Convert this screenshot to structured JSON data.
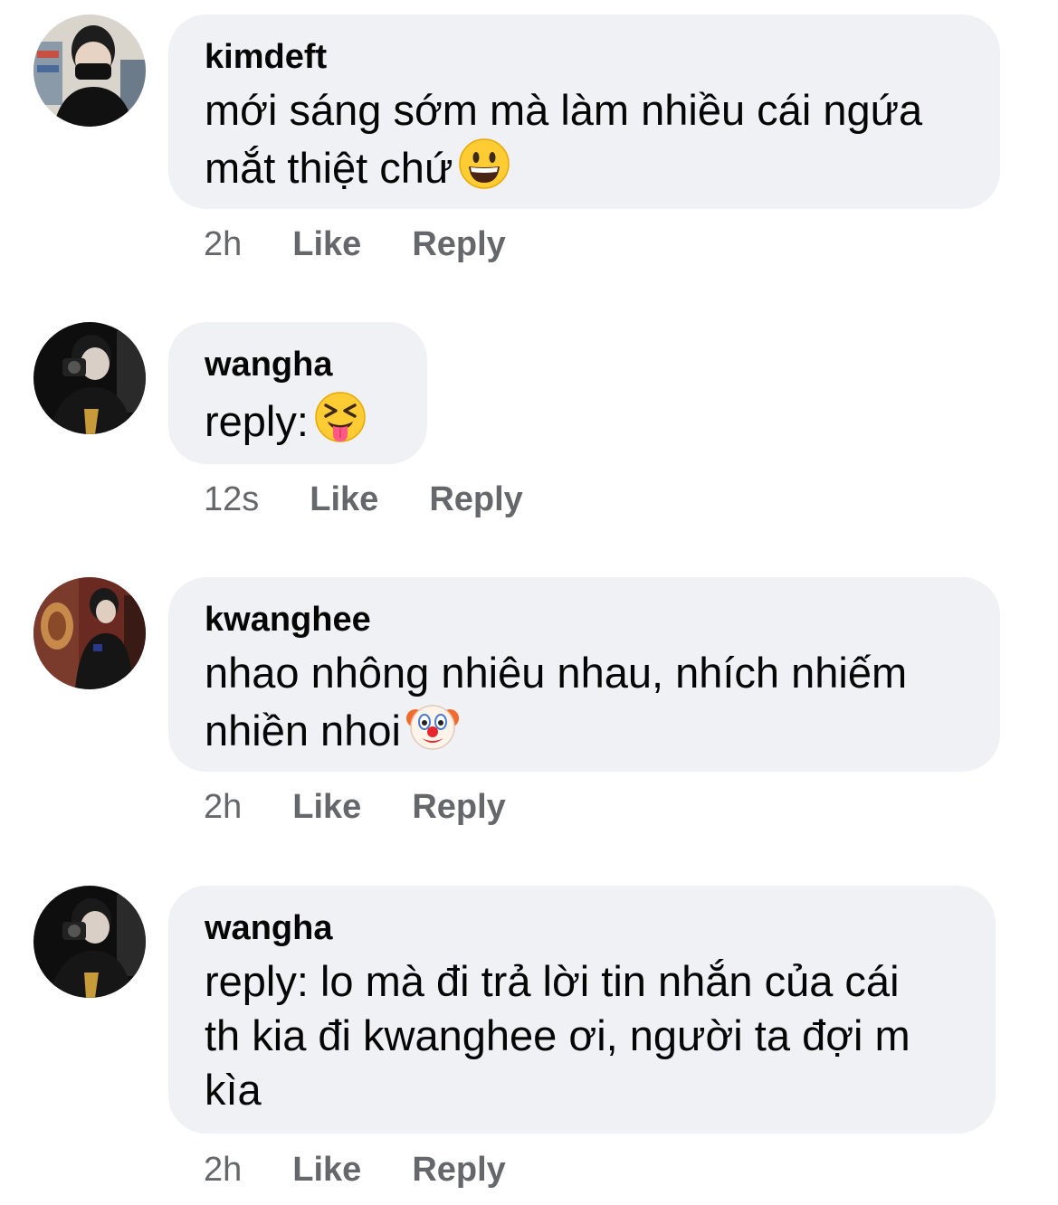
{
  "comments": [
    {
      "author": "kimdeft",
      "lines": [
        "mới sáng sớm mà làm nhiều cái ngứa",
        "mắt thiệt chứ"
      ],
      "emoji": "grinning-face",
      "time": "2h",
      "like": "Like",
      "reply": "Reply"
    },
    {
      "author": "wangha",
      "lines": [
        "reply:"
      ],
      "emoji": "squinting-tongue-face",
      "time": "12s",
      "like": "Like",
      "reply": "Reply"
    },
    {
      "author": "kwanghee",
      "lines": [
        "nhao nhông nhiêu nhau, nhích nhiếm",
        "nhiền nhoi"
      ],
      "emoji": "clown-face",
      "time": "2h",
      "like": "Like",
      "reply": "Reply"
    },
    {
      "author": "wangha",
      "lines": [
        "reply: lo mà đi trả lời tin nhắn của cái",
        "th kia đi kwanghee ơi, người ta đợi m",
        "kìa"
      ],
      "emoji": "",
      "time": "2h",
      "like": "Like",
      "reply": "Reply"
    }
  ],
  "colors": {
    "bubble": "#f0f1f5",
    "meta": "#65676b",
    "text": "#050505"
  }
}
